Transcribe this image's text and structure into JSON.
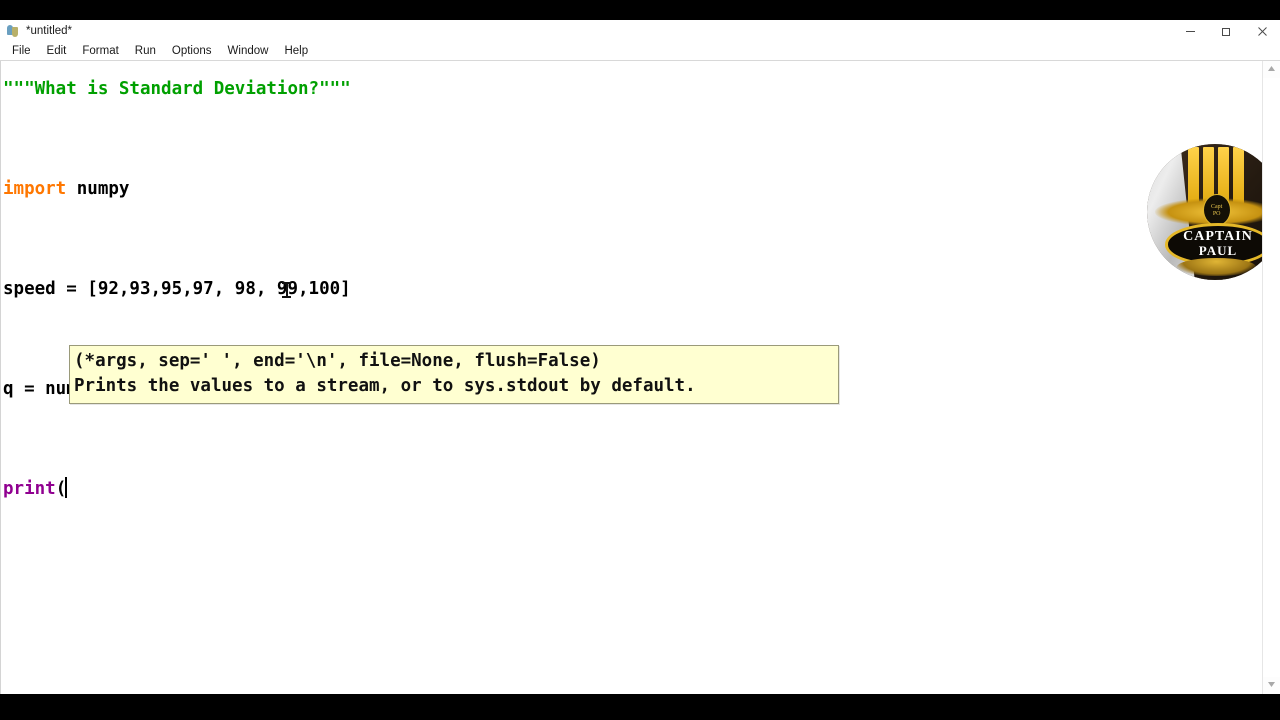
{
  "window": {
    "title": "*untitled*",
    "app_icon": "python-idle-icon",
    "controls": {
      "minimize": "minimize-icon",
      "restore": "restore-icon",
      "close": "close-icon"
    }
  },
  "menubar": {
    "items": [
      {
        "label": "File"
      },
      {
        "label": "Edit"
      },
      {
        "label": "Format"
      },
      {
        "label": "Run"
      },
      {
        "label": "Options"
      },
      {
        "label": "Window"
      },
      {
        "label": "Help"
      }
    ]
  },
  "editor": {
    "lines": [
      {
        "id": "docstring",
        "tokens": [
          {
            "text": "\"\"\"What is Standard Deviation?\"\"\"",
            "type": "string"
          }
        ]
      },
      {
        "id": "blank1",
        "tokens": []
      },
      {
        "id": "import",
        "tokens": [
          {
            "text": "import",
            "type": "keyword"
          },
          {
            "text": " numpy",
            "type": "plain"
          }
        ]
      },
      {
        "id": "blank2",
        "tokens": []
      },
      {
        "id": "speed",
        "tokens": [
          {
            "text": "speed = [92,93,95,97, 98, 99,100]",
            "type": "plain"
          }
        ]
      },
      {
        "id": "blank3",
        "tokens": []
      },
      {
        "id": "std",
        "tokens": [
          {
            "text": "q = numpy.std(speed)",
            "type": "plain"
          }
        ]
      },
      {
        "id": "blank4",
        "tokens": []
      },
      {
        "id": "print",
        "tokens": [
          {
            "text": "print",
            "type": "builtin"
          },
          {
            "text": "(",
            "type": "plain"
          }
        ],
        "caret": true
      }
    ]
  },
  "calltip": {
    "signature": "(*args, sep=' ', end='\\n', file=None, flush=False)",
    "description": "Prints the values to a stream, or to sys.stdout by default.",
    "background_color": "#ffffd1",
    "border_color": "#9a9a7a"
  },
  "watermark": {
    "title_line1": "CAPTAIN",
    "title_line2": "PAUL",
    "badge_line1": "Capt",
    "badge_line2": "PO"
  },
  "scrollbar": {
    "up_arrow": "scroll-up-icon",
    "down_arrow": "scroll-down-icon"
  },
  "cursor": {
    "type": "i-beam-cursor"
  },
  "colors": {
    "string": "#00a000",
    "keyword": "#ff7700",
    "builtin": "#900090",
    "plain": "#000000",
    "editor_bg": "#ffffff"
  }
}
